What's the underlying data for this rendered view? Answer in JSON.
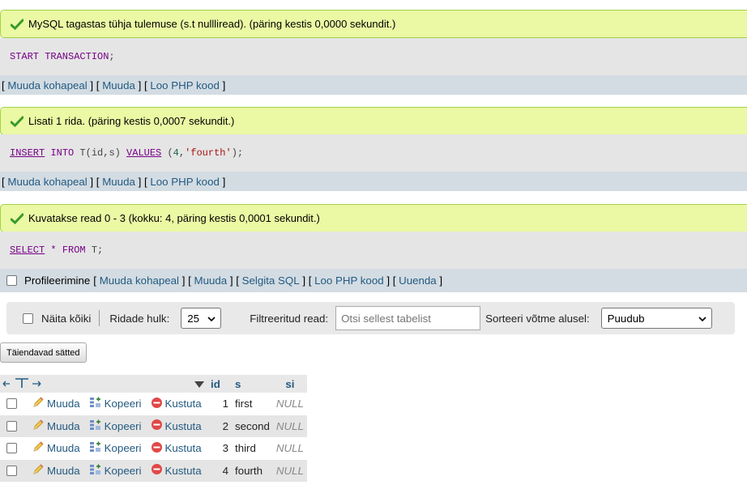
{
  "messages": [
    {
      "text": "MySQL tagastas tühja tulemuse (s.t nullliread). (päring kestis 0,0000 sekundit.)",
      "sql": [
        {
          "t": "START TRANSACTION",
          "c": "kw"
        },
        {
          "t": ";",
          "c": ""
        }
      ]
    },
    {
      "text": "Lisati 1 rida. (päring kestis 0,0007 sekundit.)",
      "sql": [
        {
          "t": "INSERT",
          "c": "kw u"
        },
        {
          "t": " ",
          "c": ""
        },
        {
          "t": "INTO",
          "c": "kw"
        },
        {
          "t": " T(id,s) ",
          "c": ""
        },
        {
          "t": "VALUES",
          "c": "kw u"
        },
        {
          "t": " (",
          "c": ""
        },
        {
          "t": "4",
          "c": "num"
        },
        {
          "t": ",",
          "c": ""
        },
        {
          "t": "'fourth'",
          "c": "str"
        },
        {
          "t": ");",
          "c": ""
        }
      ]
    },
    {
      "text": "Kuvatakse read 0 - 3 (kokku: 4, päring kestis 0,0001 sekundit.)",
      "sql": [
        {
          "t": "SELECT",
          "c": "kw u"
        },
        {
          "t": " ",
          "c": ""
        },
        {
          "t": "*",
          "c": "op"
        },
        {
          "t": " ",
          "c": ""
        },
        {
          "t": "FROM",
          "c": "kw"
        },
        {
          "t": " T;",
          "c": ""
        }
      ]
    }
  ],
  "links": {
    "edit_inline": "Muuda kohapeal",
    "edit": "Muuda",
    "create_php": "Loo PHP kood",
    "explain": "Selgita SQL",
    "refresh": "Uuenda",
    "profiling": "Profileerimine"
  },
  "nav": {
    "show_all": "Näita kõiki",
    "rows_label": "Ridade hulk:",
    "rows_value": "25",
    "filter_label": "Filtreeritud read:",
    "filter_placeholder": "Otsi sellest tabelist",
    "sort_label": "Sorteeri võtme alusel:",
    "sort_value": "Puudub"
  },
  "extra_options": "Täiendavad sätted",
  "table": {
    "columns": [
      "id",
      "s",
      "si"
    ],
    "actions": {
      "edit": "Muuda",
      "copy": "Kopeeri",
      "delete": "Kustuta"
    },
    "null_text": "NULL",
    "rows": [
      {
        "id": "1",
        "s": "first",
        "si": "NULL"
      },
      {
        "id": "2",
        "s": "second",
        "si": "NULL"
      },
      {
        "id": "3",
        "s": "third",
        "si": "NULL"
      },
      {
        "id": "4",
        "s": "fourth",
        "si": "NULL"
      }
    ]
  },
  "colors": {
    "success_bg": "#ebf8a4",
    "link": "#235a81",
    "sql_bg": "#e5e5e5",
    "links_bg": "#d3dce3"
  }
}
